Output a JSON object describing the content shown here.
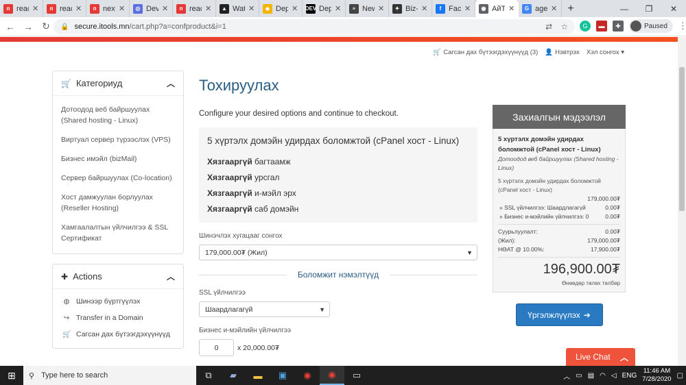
{
  "browser": {
    "tabs": [
      {
        "label": "reac",
        "fav_color": "#e53935",
        "fav_glyph": "п"
      },
      {
        "label": "reac",
        "fav_color": "#e53935",
        "fav_glyph": "п"
      },
      {
        "label": "next",
        "fav_color": "#e53935",
        "fav_glyph": "п"
      },
      {
        "label": "Dev",
        "fav_color": "#5b6ee1",
        "fav_glyph": "◎"
      },
      {
        "label": "reac",
        "fav_color": "#e53935",
        "fav_glyph": "п"
      },
      {
        "label": "Wat",
        "fav_color": "#222222",
        "fav_glyph": "▲"
      },
      {
        "label": "Dep",
        "fav_color": "#f5b400",
        "fav_glyph": "◆"
      },
      {
        "label": "Dep",
        "fav_color": "#000000",
        "fav_glyph": "DEV"
      },
      {
        "label": "New",
        "fav_color": "#444444",
        "fav_glyph": "≡"
      },
      {
        "label": "Biz-",
        "fav_color": "#333333",
        "fav_glyph": "✦"
      },
      {
        "label": "Face",
        "fav_color": "#1877f2",
        "fav_glyph": "f"
      },
      {
        "label": "АйТ",
        "fav_color": "#5f6368",
        "fav_glyph": "◉"
      },
      {
        "label": "age",
        "fav_color": "#4285f4",
        "fav_glyph": "G"
      }
    ],
    "active_tab_index": 11,
    "url_host": "secure.itools.mn",
    "url_path": "/cart.php?a=confproduct&i=1",
    "profile_status": "Paused"
  },
  "toplinks": {
    "cart": "Сагсан дах бүтээгдэхүүнүүд (3)",
    "login": "Нэвтрэх",
    "language": "Хэл сонгох"
  },
  "sidebar": {
    "categories_title": "Категориуд",
    "categories": [
      "Дотоодод веб байршуулах (Shared hosting - Linux)",
      "Виртуал сервер түрээслэх (VPS)",
      "Бизнес имэйл (bizMail)",
      "Сервер байршуулах (Co-location)",
      "Хост дамжуулан борлуулах (Reseller Hosting)",
      "Хамгаалалтын үйлчилгээ & SSL Сертификат"
    ],
    "actions_title": "Actions",
    "actions": [
      {
        "label": "Шинээр бүртгүүлэх",
        "icon": "globe-icon",
        "glyph": "◍"
      },
      {
        "label": "Transfer in a Domain",
        "icon": "share-icon",
        "glyph": "↪"
      },
      {
        "label": "Сагсан дах бүтээгдэхүүнүүд",
        "icon": "cart-icon",
        "glyph": "🛒"
      }
    ]
  },
  "main": {
    "title": "Тохируулах",
    "description": "Configure your desired options and continue to checkout.",
    "product_name": "5 хүртэлх домэйн удирдах боломжтой (cPanel хост - Linux)",
    "features": [
      {
        "bold": "Хязгааргүй",
        "text": " багтаамж"
      },
      {
        "bold": "Хязгааргүй",
        "text": " урсгал"
      },
      {
        "bold": "Хязгааргүй",
        "text": " и-мэйл эрх"
      },
      {
        "bold": "Хязгааргүй",
        "text": " саб домэйн"
      }
    ],
    "billing_label": "Шинэчлэх хугацааг сонгох",
    "billing_value": "179,000.00₮ (Жил)",
    "addons_heading": "Боломжит нэмэлтүүд",
    "ssl_label": "SSL үйлчилгээ",
    "ssl_value": "Шаардлагагүй",
    "email_label": "Бизнес и-мэйлийн үйлчилгээ",
    "email_qty": "0",
    "email_price": "x 20,000.00₮"
  },
  "order": {
    "heading": "Захиалгын мэдээлэл",
    "product_title": "5 хүртэлх домэйн удирдах боломжтой (cPanel хост - Linux)",
    "product_group": "Дотоодод веб байршуулах (Shared hosting - Linux)",
    "product_desc": "5 хүртэлх домэйн удирдах боломжтой (cPanel хост - Linux)",
    "product_price": "179,000.00₮",
    "options": [
      {
        "label": "» SSL үйлчилгээ: Шаардлагагүй",
        "value": "0.00₮"
      },
      {
        "label": "» Бизнес и-мэйлийн үйлчилгээ: 0",
        "value": "0.00₮"
      }
    ],
    "summary": [
      {
        "label": "Суурьлуулалт:",
        "value": "0.00₮"
      },
      {
        "label": "(Жил):",
        "value": "179,000.00₮"
      },
      {
        "label": "НӨАТ @ 10.00%:",
        "value": "17,900.00₮"
      }
    ],
    "total": "196,900.00₮",
    "total_label": "Өнөөдөр төлөх төлбөр",
    "continue_button": "Үргэлжлүүлэх"
  },
  "livechat": {
    "label": "Live Chat"
  },
  "taskbar": {
    "search_placeholder": "Type here to search",
    "language": "ENG",
    "time": "11:46 AM",
    "date": "7/28/2020"
  },
  "colors": {
    "accent_blue": "#2a5d84",
    "button_blue": "#2a7ac1",
    "livechat_red": "#f0533c",
    "order_header": "#666666"
  }
}
